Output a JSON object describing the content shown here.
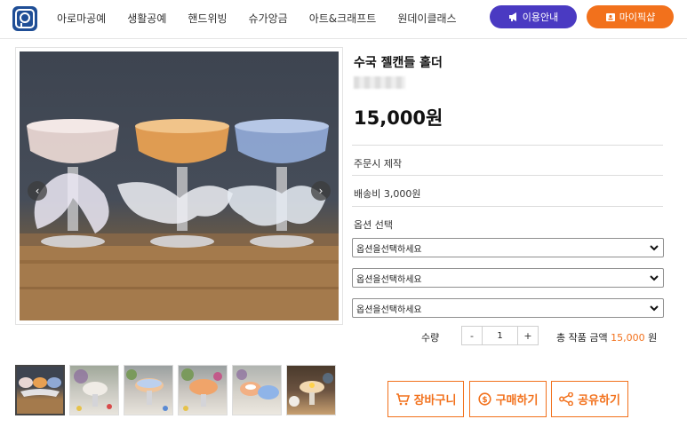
{
  "header": {
    "logo_icon": "logo-icon",
    "nav": [
      "아로마공예",
      "생활공예",
      "핸드위빙",
      "슈가앙금",
      "아트&크래프트",
      "원데이클래스"
    ],
    "guide_button": "이용안내",
    "mypage_button": "마이픽샵",
    "colors": {
      "guide": "#4a3ac2",
      "mypage": "#f2711c"
    }
  },
  "product": {
    "title": "수국 젤캔들 홀더",
    "price": "15,000원",
    "made_to_order": "주문시 제작",
    "shipping": "배송비 3,000원",
    "option_label": "옵션 선택",
    "option_placeholders": [
      "옵션을선택하세요",
      "옵션을선택하세요",
      "옵션을선택하세요"
    ],
    "qty_label": "수량",
    "qty_minus": "-",
    "qty_value": "1",
    "qty_plus": "+",
    "total_label": "총 작품 금액",
    "total_amount": "15,000",
    "total_unit": "원"
  },
  "gallery": {
    "prev_icon": "chevron-left-icon",
    "next_icon": "chevron-right-icon",
    "thumb_count": 6,
    "active_thumb": 0
  },
  "actions": {
    "cart": "장바구니",
    "buy": "구매하기",
    "share": "공유하기",
    "accent_color": "#f2711c"
  }
}
